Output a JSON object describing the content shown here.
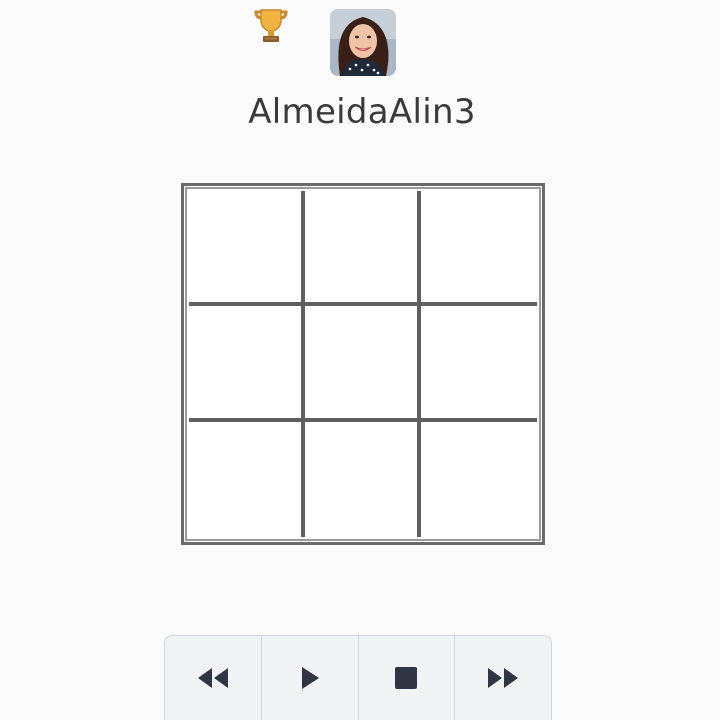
{
  "player": {
    "username": "AlmeidaAlin3",
    "trophy_icon": "trophy-icon",
    "avatar_icon": "avatar"
  },
  "board": {
    "rows": 3,
    "cols": 3,
    "cells": [
      [
        "",
        "",
        ""
      ],
      [
        "",
        "",
        ""
      ],
      [
        "",
        "",
        ""
      ]
    ]
  },
  "controls": [
    {
      "name": "rewind-button",
      "icon": "rewind-icon"
    },
    {
      "name": "play-button",
      "icon": "play-icon"
    },
    {
      "name": "stop-button",
      "icon": "stop-icon"
    },
    {
      "name": "fast-forward-button",
      "icon": "fast-forward-icon"
    }
  ],
  "colors": {
    "board_line": "#5f5f5f",
    "control_icon": "#2f3542",
    "background": "#fbfbfc"
  }
}
